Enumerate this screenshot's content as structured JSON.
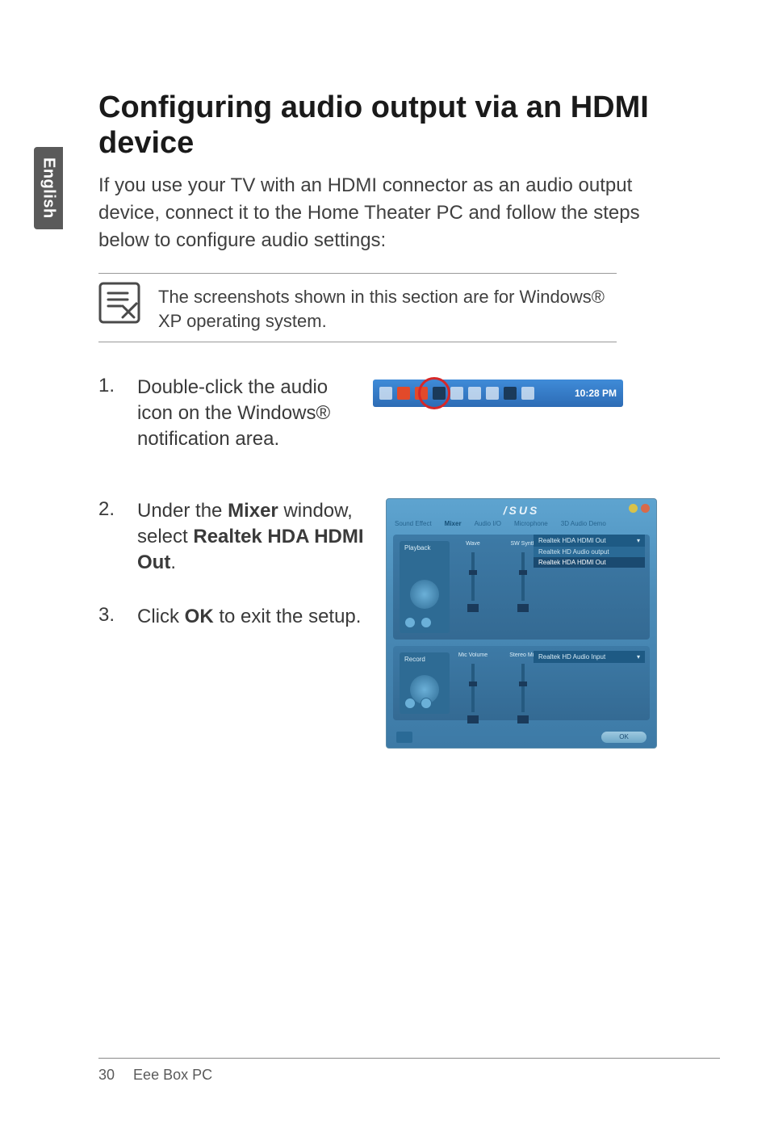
{
  "side_tab": {
    "label": "English"
  },
  "title": "Configuring audio output via an HDMI device",
  "intro": "If you use your TV with an HDMI connector as an audio output device, connect it to the Home Theater PC and follow the steps below to configure audio settings:",
  "note": "The screenshots shown in this section are for Windows® XP operating system.",
  "steps": {
    "s1_num": "1.",
    "s1_text": "Double-click the audio icon on the Windows® notification area.",
    "s2_num": "2.",
    "s2_pre": "Under the ",
    "s2_b1": "Mixer",
    "s2_mid": " window, select ",
    "s2_b2": "Realtek HDA HDMI Out",
    "s2_post": ".",
    "s3_num": "3.",
    "s3_pre": "Click ",
    "s3_b1": "OK",
    "s3_post": " to exit the setup."
  },
  "taskbar": {
    "time": "10:28 PM"
  },
  "mixer": {
    "brand": "/SUS",
    "tabs": [
      "Sound Effect",
      "Mixer",
      "Audio I/O",
      "Microphone",
      "3D Audio Demo"
    ],
    "playback_label": "Playback",
    "record_label": "Record",
    "ch_wave": "Wave",
    "ch_sw": "SW Synth",
    "ch_mic": "Mic Volume",
    "ch_stereo": "Stereo Mix",
    "dd_selected": "Realtek HDA HDMI Out",
    "dd_opt1": "Realtek HD Audio output",
    "dd_opt2": "Realtek HDA HDMI Out",
    "dd_rec": "Realtek HD Audio Input",
    "ok": "OK"
  },
  "footer": {
    "page_num": "30",
    "doc_title": "Eee Box PC"
  }
}
